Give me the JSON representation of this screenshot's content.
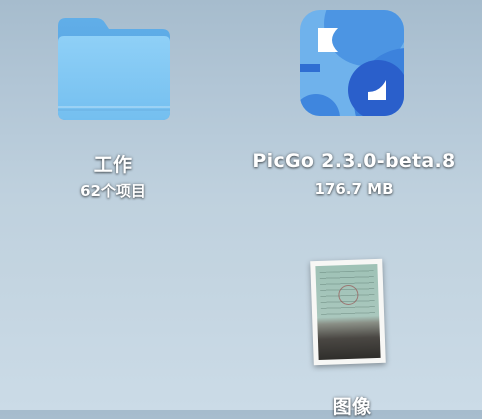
{
  "desktop": {
    "items": [
      {
        "kind": "folder",
        "icon": "folder-icon",
        "name": "工作",
        "meta": "62个项目",
        "colors": {
          "folder_front": "#7ec6f2",
          "folder_back": "#5aa8e6"
        }
      },
      {
        "kind": "application",
        "icon": "picgo-app-icon",
        "name": "PicGo 2.3.0-beta.8",
        "meta": "176.7 MB",
        "colors": {
          "light": "#6fb0ea",
          "mid": "#3f84dd",
          "dark": "#2657c5"
        }
      },
      {
        "kind": "image",
        "icon": "image-thumbnail",
        "name": "图像"
      }
    ]
  }
}
